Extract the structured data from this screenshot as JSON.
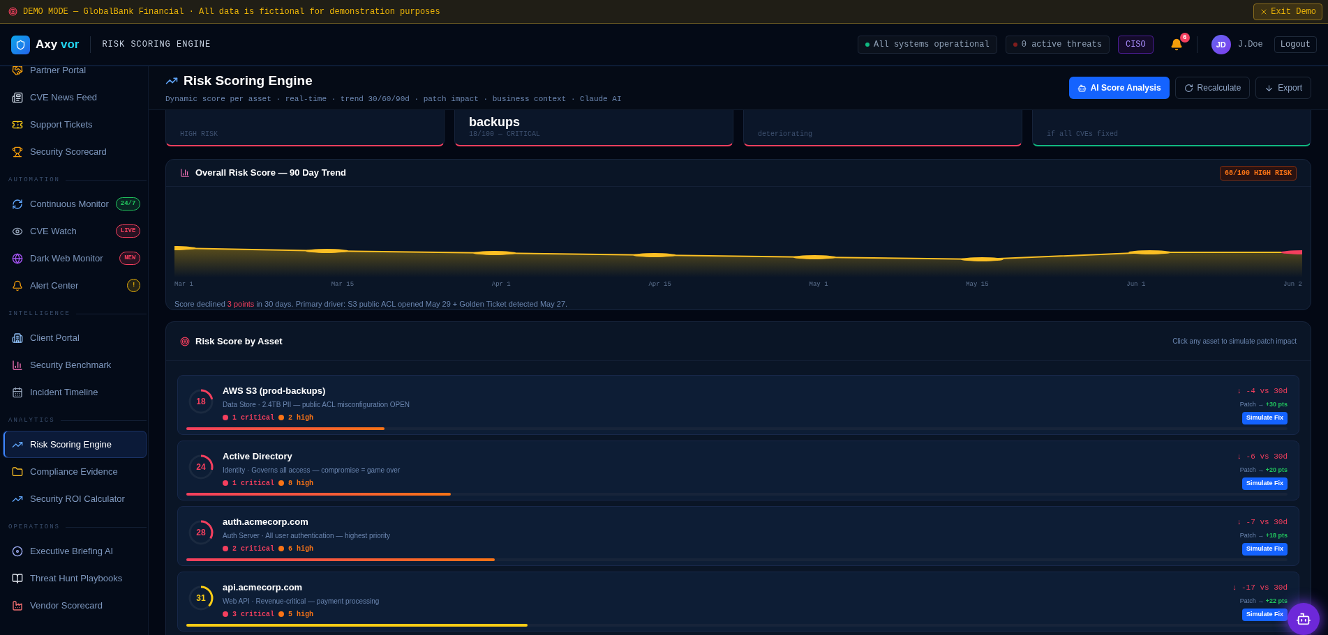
{
  "demo_banner": {
    "text": "DEMO MODE — GlobalBank Financial · All data is fictional for demonstration purposes",
    "exit_label": "Exit Demo"
  },
  "header": {
    "logo_first": "Axy",
    "logo_second": "vor",
    "page_label": "RISK SCORING ENGINE",
    "status": "All systems operational",
    "threats": "0 active threats",
    "role": "CISO",
    "notifications": "6",
    "avatar": "JD",
    "user": "J.Doe",
    "logout": "Logout"
  },
  "sidebar": [
    {
      "kind": "item",
      "label": "Partner Portal",
      "selected": false
    },
    {
      "kind": "item",
      "label": "CVE News Feed",
      "selected": false
    },
    {
      "kind": "item",
      "label": "Support Tickets",
      "selected": false
    },
    {
      "kind": "item",
      "label": "Security Scorecard",
      "selected": false
    },
    {
      "kind": "section",
      "label": "AUTOMATION"
    },
    {
      "kind": "item",
      "label": "Continuous Monitor",
      "selected": false,
      "badge": "24/7",
      "color": "#22c55e"
    },
    {
      "kind": "item",
      "label": "CVE Watch",
      "selected": false,
      "badge": "LIVE",
      "color": "#f43f5e"
    },
    {
      "kind": "item",
      "label": "Dark Web Monitor",
      "selected": false,
      "badge": "NEW",
      "color": "#f43f5e"
    },
    {
      "kind": "item",
      "label": "Alert Center",
      "selected": false,
      "badge": "!",
      "color": "#eab308"
    },
    {
      "kind": "section",
      "label": "INTELLIGENCE"
    },
    {
      "kind": "item",
      "label": "Client Portal",
      "selected": false
    },
    {
      "kind": "item",
      "label": "Security Benchmark",
      "selected": false
    },
    {
      "kind": "item",
      "label": "Incident Timeline",
      "selected": false
    },
    {
      "kind": "section",
      "label": "ANALYTICS"
    },
    {
      "kind": "item",
      "label": "Risk Scoring Engine",
      "selected": true
    },
    {
      "kind": "item",
      "label": "Compliance Evidence",
      "selected": false
    },
    {
      "kind": "item",
      "label": "Security ROI Calculator",
      "selected": false
    },
    {
      "kind": "section",
      "label": "OPERATIONS"
    },
    {
      "kind": "item",
      "label": "Executive Briefing AI",
      "selected": false
    },
    {
      "kind": "item",
      "label": "Threat Hunt Playbooks",
      "selected": false
    },
    {
      "kind": "item",
      "label": "Vendor Scorecard",
      "selected": false
    }
  ],
  "page": {
    "title": "Risk Scoring Engine",
    "subtitle": "Dynamic score per asset · real-time · trend 30/60/90d · patch impact · business context · Claude AI",
    "actions": [
      {
        "kind": "primary",
        "label": "AI Score Analysis"
      },
      {
        "kind": "refresh",
        "label": "Recalculate"
      },
      {
        "kind": "export",
        "label": "Export"
      }
    ]
  },
  "summary_cards": [
    {
      "note": "HIGH RISK",
      "color": "#f43f5e"
    },
    {
      "value": "backups",
      "note": "18/100 — CRITICAL",
      "color": "#f43f5e"
    },
    {
      "note": "deteriorating",
      "color": "#f43f5e"
    },
    {
      "note": "if all CVEs fixed",
      "color": "#10b981"
    }
  ],
  "trend_panel": {
    "title": "Overall Risk Score — 90 Day Trend",
    "badge": "68/100 HIGH RISK",
    "x_labels": [
      "Mar 1",
      "Mar 15",
      "Apr 1",
      "Apr 15",
      "May 1",
      "May 15",
      "Jun 1",
      "Jun 2"
    ],
    "caption_before": "Score declined ",
    "caption_highlight": "3 points",
    "caption_after": " in 30 days. Primary driver: S3 public ACL opened May 29 + Golden Ticket detected May 27."
  },
  "asset_panel": {
    "title": "Risk Score by Asset",
    "hint": "Click any asset to simulate patch impact",
    "assets": [
      {
        "score": "18",
        "level": 0.18,
        "color": "#f43f5e",
        "name": "AWS S3 (prod-backups)",
        "description": "Data Store · 2.4TB PII — public ACL misconfiguration OPEN",
        "critical": "1 critical",
        "high": "2 high",
        "trend": "↓ -4 vs 30d",
        "patch_label": "Patch →",
        "patch_gain": "+30 pts",
        "button": "Simulate Fix"
      },
      {
        "score": "24",
        "level": 0.24,
        "color": "#f43f5e",
        "name": "Active Directory",
        "description": "Identity · Governs all access — compromise = game over",
        "critical": "1 critical",
        "high": "8 high",
        "trend": "↓ -6 vs 30d",
        "patch_label": "Patch →",
        "patch_gain": "+20 pts",
        "button": "Simulate Fix"
      },
      {
        "score": "28",
        "level": 0.28,
        "color": "#f43f5e",
        "name": "auth.acmecorp.com",
        "description": "Auth Server · All user authentication — highest priority",
        "critical": "2 critical",
        "high": "6 high",
        "trend": "↓ -7 vs 30d",
        "patch_label": "Patch →",
        "patch_gain": "+18 pts",
        "button": "Simulate Fix"
      },
      {
        "score": "31",
        "level": 0.31,
        "color": "#facc15",
        "name": "api.acmecorp.com",
        "description": "Web API · Revenue-critical — payment processing",
        "critical": "3 critical",
        "high": "5 high",
        "trend": "↓ -17 vs 30d",
        "patch_label": "Patch →",
        "patch_gain": "+22 pts",
        "button": "Simulate Fix"
      }
    ]
  }
}
